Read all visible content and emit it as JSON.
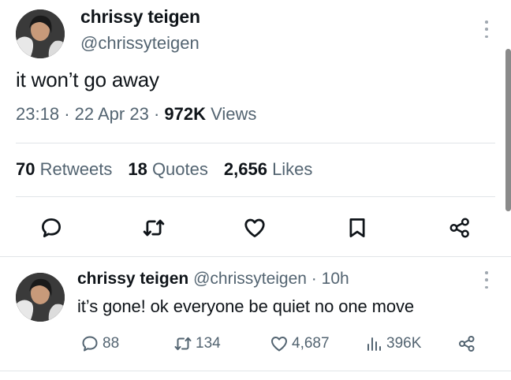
{
  "tweet": {
    "display_name": "chrissy teigen",
    "handle": "@chrissyteigen",
    "text": "it won’t go away",
    "time": "23:18",
    "date": "22 Apr 23",
    "views_count": "972K",
    "views_label": "Views",
    "separator": "·"
  },
  "stats": {
    "retweets_count": "70",
    "retweets_label": "Retweets",
    "quotes_count": "18",
    "quotes_label": "Quotes",
    "likes_count": "2,656",
    "likes_label": "Likes"
  },
  "actions": [
    "reply-icon",
    "retweet-icon",
    "like-icon",
    "bookmark-icon",
    "share-icon"
  ],
  "reply": {
    "display_name": "chrissy teigen",
    "handle": "@chrissyteigen",
    "separator": "·",
    "age": "10h",
    "text": "it’s gone! ok everyone be quiet no one move",
    "replies": "88",
    "retweets": "134",
    "likes": "4,687",
    "views": "396K"
  },
  "colors": {
    "text": "#0f1419",
    "secondary": "#536471",
    "divider": "#e1e5e8"
  }
}
